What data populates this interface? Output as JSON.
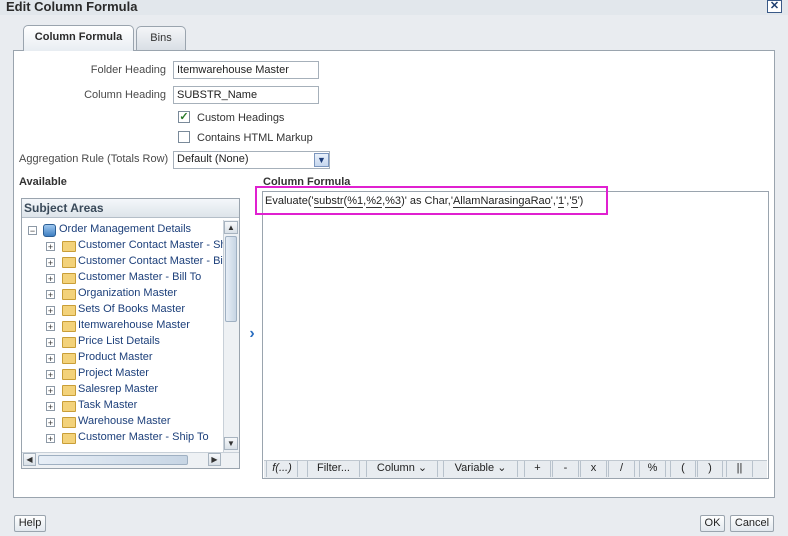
{
  "window": {
    "title": "Edit Column Formula",
    "close_glyph": "✕"
  },
  "tabs": [
    {
      "label": "Column Formula"
    },
    {
      "label": "Bins"
    }
  ],
  "form": {
    "folder_heading_label": "Folder Heading",
    "folder_heading_value": "Itemwarehouse Master",
    "column_heading_label": "Column Heading",
    "column_heading_value": "SUBSTR_Name",
    "custom_headings_label": "Custom Headings",
    "custom_headings_checked": true,
    "contains_html_label": "Contains HTML Markup",
    "contains_html_checked": false,
    "aggregation_label": "Aggregation Rule (Totals Row)",
    "aggregation_value": "Default (None)"
  },
  "available": {
    "heading": "Available",
    "subject_areas_title": "Subject Areas",
    "root": "Order Management Details",
    "items": [
      "Customer Contact Master - Sh",
      "Customer Contact Master - Bil",
      "Customer Master - Bill To",
      "Organization Master",
      "Sets Of Books Master",
      "Itemwarehouse Master",
      "Price List Details",
      "Product Master",
      "Project Master",
      "Salesrep Master",
      "Task Master",
      "Warehouse Master",
      "Customer Master - Ship To"
    ]
  },
  "formula": {
    "heading": "Column Formula",
    "parts": {
      "p1": "Evaluate('",
      "p2": "substr",
      "p3": "(",
      "p4": "%1",
      "p5": ",",
      "p6": "%2",
      "p7": ",",
      "p8": "%3",
      "p9": ")' as Char,'",
      "p10": "AllamNarasingaRao",
      "p11": "','",
      "p12": "1",
      "p13": "','",
      "p14": "5",
      "p15": "')"
    },
    "highlight_color": "#e020d0"
  },
  "toolbar": {
    "func": "f(...)",
    "filter": "Filter...",
    "column": "Column",
    "variable": "Variable",
    "plus": "+",
    "minus": "-",
    "times": "x",
    "divide": "/",
    "percent": "%",
    "lparen": "(",
    "rparen": ")",
    "concat": "||"
  },
  "buttons": {
    "help": "Help",
    "ok": "OK",
    "cancel": "Cancel"
  },
  "icons": {
    "move": "chevron-right-icon",
    "dropdown": "chevron-down-icon"
  }
}
